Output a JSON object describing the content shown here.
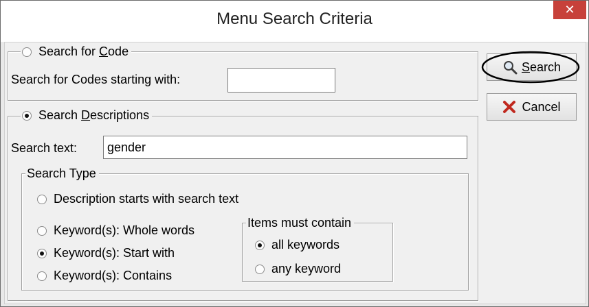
{
  "window": {
    "title": "Menu Search Criteria",
    "close_glyph": "✕"
  },
  "code_group": {
    "legend_pre": "Search for ",
    "legend_key": "C",
    "legend_post": "ode",
    "selected": false,
    "starting_label": "Search for Codes starting with:",
    "starting_value": ""
  },
  "desc_group": {
    "legend_pre": "Search ",
    "legend_key": "D",
    "legend_post": "escriptions",
    "selected": true,
    "search_text_label": "Search text:",
    "search_text_value": "gender"
  },
  "search_type": {
    "legend": "Search Type",
    "options": [
      {
        "label": "Description starts with search text",
        "selected": false
      },
      {
        "label": "Keyword(s): Whole words",
        "selected": false
      },
      {
        "label": "Keyword(s): Start with",
        "selected": true
      },
      {
        "label": "Keyword(s): Contains",
        "selected": false
      }
    ]
  },
  "items_must_contain": {
    "legend": "Items must contain",
    "options": [
      {
        "label": "all keywords",
        "selected": true
      },
      {
        "label": "any keyword",
        "selected": false
      }
    ]
  },
  "buttons": {
    "search_key": "S",
    "search_rest": "earch",
    "search_icon": "magnifier-icon",
    "cancel_label": "Cancel",
    "cancel_icon": "red-x-icon"
  },
  "colors": {
    "close_button": "#c7413a",
    "cancel_x": "#c0281e",
    "annotation_circle": "#000000"
  }
}
